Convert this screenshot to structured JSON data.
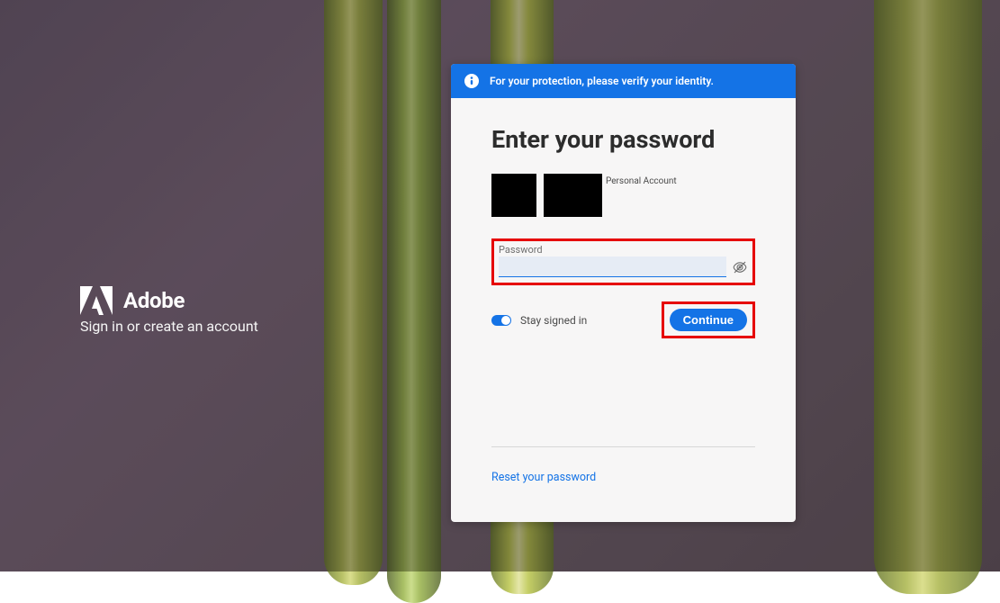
{
  "brand": {
    "name": "Adobe",
    "tagline": "Sign in or create an account"
  },
  "banner": {
    "text": "For your protection, please verify your identity."
  },
  "form": {
    "heading": "Enter your password",
    "account_type": "Personal Account",
    "password_label": "Password",
    "password_value": "",
    "stay_signed_label": "Stay signed in",
    "continue_label": "Continue",
    "reset_label": "Reset your password"
  },
  "highlights": {
    "password_box_color": "#e60000",
    "continue_box_color": "#e60000"
  },
  "colors": {
    "accent": "#1473e6"
  }
}
